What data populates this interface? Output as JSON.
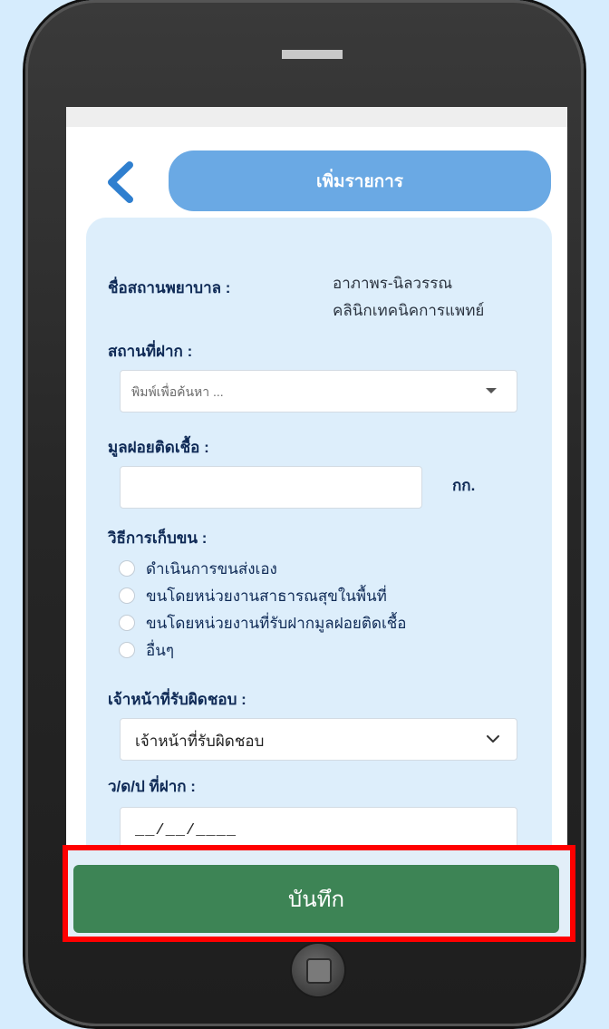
{
  "header": {
    "title": "เพิ่มรายการ"
  },
  "form": {
    "hospital_label": "ชื่อสถานพยาบาล :",
    "hospital_value_line1": "อาภาพร-นิลวรรณ",
    "hospital_value_line2": "คลินิกเทคนิคการแพทย์",
    "deposit_place_label": "สถานที่ฝาก :",
    "deposit_place_placeholder": "พิมพ์เพื่อค้นหา ...",
    "waste_label": "มูลฝอยติดเชื้อ :",
    "waste_value": "",
    "waste_unit": "กก.",
    "collection_method_label": "วิธีการเก็บขน :",
    "collection_options": [
      "ดำเนินการขนส่งเอง",
      "ขนโดยหน่วยงานสาธารณสุขในพื้นที่",
      "ขนโดยหน่วยงานที่รับฝากมูลฝอยติดเชื้อ",
      "อื่นๆ"
    ],
    "officer_label": "เจ้าหน้าที่รับผิดชอบ :",
    "officer_selected": "เจ้าหน้าที่รับผิดชอบ",
    "date_label": "ว/ด/ป ที่ฝาก :",
    "date_value": "__/__/____"
  },
  "footer": {
    "save_label": "บันทึก"
  },
  "colors": {
    "background": "#d6ecfd",
    "header_pill": "#6aa9e4",
    "card": "#ddeefb",
    "save_button": "#3d8455",
    "highlight": "#ff0000",
    "label_text": "#0f2a56"
  },
  "icons": {
    "back": "chevron-left-icon",
    "deposit_dropdown": "caret-down-icon",
    "officer_dropdown": "chevron-down-icon",
    "home": "home-button-icon"
  }
}
